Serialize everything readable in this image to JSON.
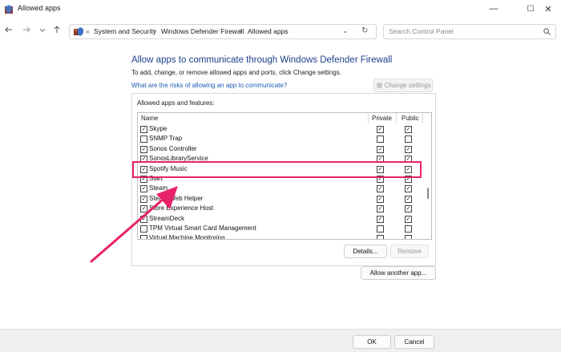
{
  "window": {
    "title": "Allowed apps",
    "controls": {
      "minimize": "—",
      "maximize": "☐",
      "close": "✕"
    }
  },
  "nav": {
    "back_icon": "arrow-left",
    "forward_icon": "arrow-right",
    "recent_icon": "chevron-down",
    "up_icon": "arrow-up",
    "prefix": "«",
    "breadcrumbs": [
      "System and Security",
      "Windows Defender Firewall",
      "Allowed apps"
    ],
    "search_placeholder": "Search Control Panel"
  },
  "main": {
    "heading": "Allow apps to communicate through Windows Defender Firewall",
    "description": "To add, change, or remove allowed apps and ports, click Change settings.",
    "risk_link": "What are the risks of allowing an app to communicate?",
    "change_settings_label": "Change settings",
    "group_label": "Allowed apps and features:",
    "columns": {
      "name": "Name",
      "private": "Private",
      "public": "Public"
    },
    "rows": [
      {
        "name": "Skype",
        "enabled": true,
        "private": true,
        "public": true
      },
      {
        "name": "SNMP Trap",
        "enabled": false,
        "private": false,
        "public": false
      },
      {
        "name": "Sonos Controller",
        "enabled": true,
        "private": true,
        "public": true
      },
      {
        "name": "SonosLibraryService",
        "enabled": true,
        "private": true,
        "public": true
      },
      {
        "name": "Spotify Music",
        "enabled": true,
        "private": true,
        "public": true
      },
      {
        "name": "Start",
        "enabled": true,
        "private": true,
        "public": true
      },
      {
        "name": "Steam",
        "enabled": true,
        "private": true,
        "public": true
      },
      {
        "name": "Steam Web Helper",
        "enabled": true,
        "private": true,
        "public": true
      },
      {
        "name": "Store Experience Host",
        "enabled": true,
        "private": true,
        "public": true
      },
      {
        "name": "StreamDeck",
        "enabled": true,
        "private": true,
        "public": true
      },
      {
        "name": "TPM Virtual Smart Card Management",
        "enabled": false,
        "private": false,
        "public": false
      },
      {
        "name": "Virtual Machine Monitoring",
        "enabled": false,
        "private": false,
        "public": false
      }
    ],
    "details_label": "Details...",
    "remove_label": "Remove",
    "allow_another_label": "Allow another app..."
  },
  "footer": {
    "ok_label": "OK",
    "cancel_label": "Cancel"
  },
  "annotation": {
    "highlight_color": "#e8226a",
    "arrow_color": "#e8226a",
    "highlighted_row": "Spotify Music"
  }
}
